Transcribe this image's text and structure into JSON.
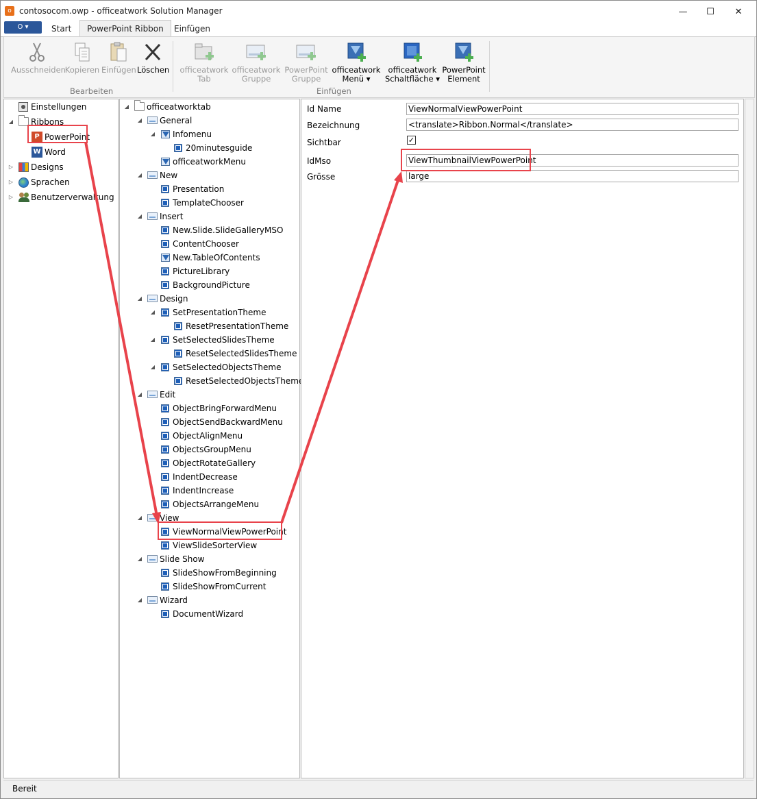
{
  "window": {
    "title": "contosocom.owp - officeatwork Solution Manager",
    "minimize": "—",
    "maximize": "☐",
    "close": "✕"
  },
  "tabs": {
    "file_label": "▾",
    "items": [
      "Start",
      "PowerPoint Ribbon",
      "Einfügen"
    ]
  },
  "ribbon": {
    "groups": [
      {
        "label": "Bearbeiten"
      },
      {
        "label": "Einfügen"
      }
    ],
    "buttons": {
      "cut": {
        "label": "Ausschneiden",
        "icon": "scissors-icon"
      },
      "copy": {
        "label": "Kopieren",
        "icon": "copy-icon"
      },
      "paste": {
        "label": "Einfügen",
        "icon": "paste-icon"
      },
      "delete": {
        "label": "Löschen",
        "icon": "delete-x-icon"
      },
      "tab": {
        "line1": "officeatwork",
        "line2": "Tab"
      },
      "group": {
        "line1": "officeatwork",
        "line2": "Gruppe"
      },
      "ppt_group": {
        "line1": "PowerPoint",
        "line2": "Gruppe"
      },
      "menu": {
        "line1": "officeatwork",
        "line2": "Menü ▾"
      },
      "button": {
        "line1": "officeatwork",
        "line2": "Schaltfläche ▾"
      },
      "element": {
        "line1": "PowerPoint",
        "line2": "Element"
      }
    }
  },
  "nav": {
    "items": [
      {
        "label": "Einstellungen",
        "icon": "settings-icon"
      },
      {
        "label": "Ribbons",
        "icon": "folder-icon"
      },
      {
        "label": "PowerPoint",
        "icon": "powerpoint-icon"
      },
      {
        "label": "Word",
        "icon": "word-icon"
      },
      {
        "label": "Designs",
        "icon": "designs-icon"
      },
      {
        "label": "Sprachen",
        "icon": "globe-icon"
      },
      {
        "label": "Benutzerverwaltung",
        "icon": "users-icon"
      }
    ]
  },
  "tree": {
    "nodes": [
      "officeatworktab",
      "General",
      "Infomenu",
      "20minutesguide",
      "officeatworkMenu",
      "New",
      "Presentation",
      "TemplateChooser",
      "Insert",
      "New.Slide.SlideGalleryMSO",
      "ContentChooser",
      "New.TableOfContents",
      "PictureLibrary",
      "BackgroundPicture",
      "Design",
      "SetPresentationTheme",
      "ResetPresentationTheme",
      "SetSelectedSlidesTheme",
      "ResetSelectedSlidesTheme",
      "SetSelectedObjectsTheme",
      "ResetSelectedObjectsTheme",
      "Edit",
      "ObjectBringForwardMenu",
      "ObjectSendBackwardMenu",
      "ObjectAlignMenu",
      "ObjectsGroupMenu",
      "ObjectRotateGallery",
      "IndentDecrease",
      "IndentIncrease",
      "ObjectsArrangeMenu",
      "View",
      "ViewNormalViewPowerPoint",
      "ViewSlideSorterView",
      "Slide Show",
      "SlideShowFromBeginning",
      "SlideShowFromCurrent",
      "Wizard",
      "DocumentWizard"
    ]
  },
  "properties": {
    "id_name": {
      "label": "Id Name",
      "value": "ViewNormalViewPowerPoint"
    },
    "bezeichnung": {
      "label": "Bezeichnung",
      "value": "<translate>Ribbon.Normal</translate>"
    },
    "sichtbar": {
      "label": "Sichtbar",
      "checked": true
    },
    "idmso": {
      "label": "IdMso",
      "value": "ViewThumbnailViewPowerPoint"
    },
    "groesse": {
      "label": "Grösse",
      "value": "large"
    }
  },
  "status": {
    "text": "Bereit"
  },
  "colors": {
    "annotation": "#e8434b",
    "accent": "#2b579a"
  }
}
